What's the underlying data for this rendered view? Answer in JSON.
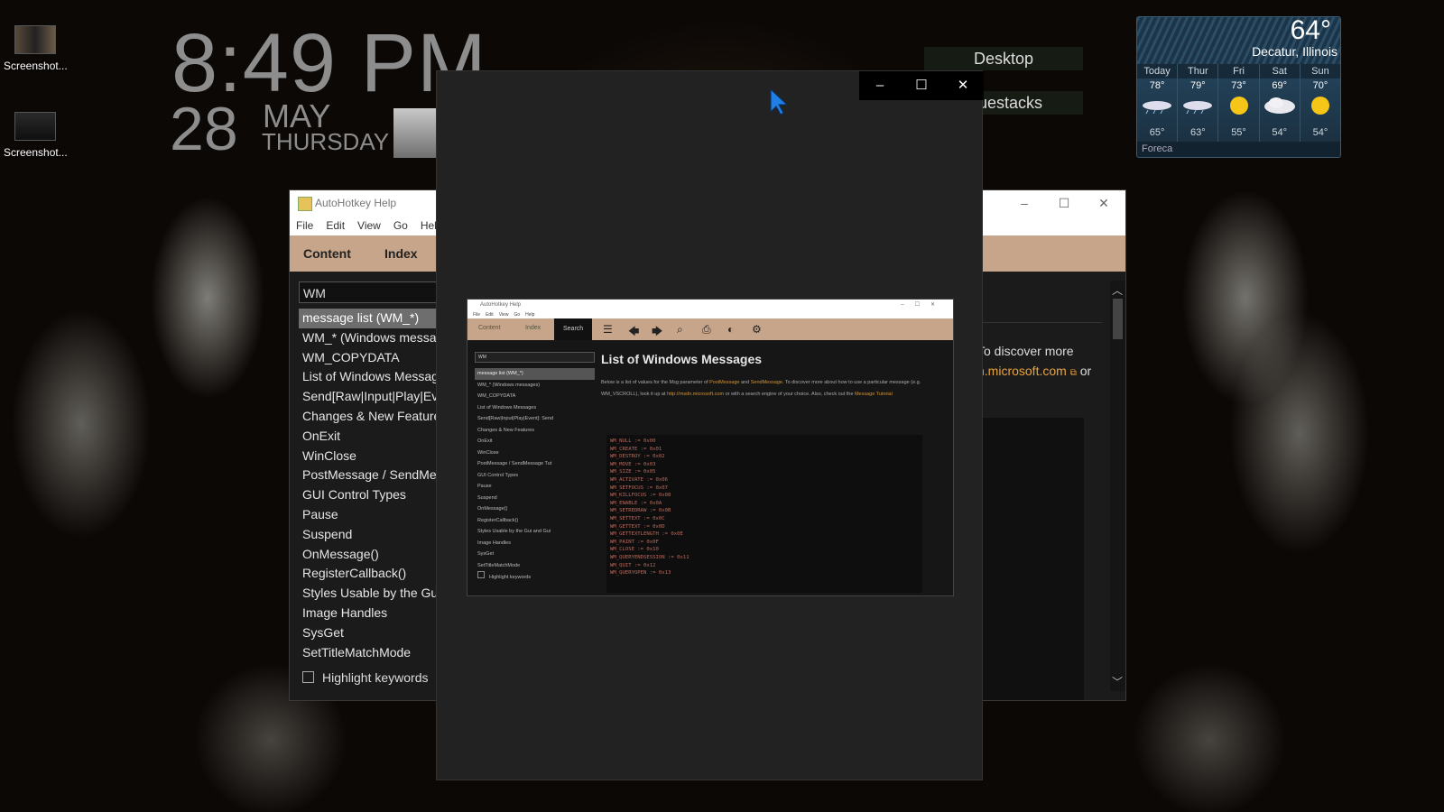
{
  "desktop": {
    "icons": [
      {
        "label": "Screenshot..."
      },
      {
        "label": "Screenshot..."
      }
    ],
    "clock": {
      "time": "8:49 PM",
      "day": "28",
      "month": "MAY",
      "weekday": "THURSDAY"
    },
    "gadget_buttons": [
      "Desktop",
      "uestacks"
    ]
  },
  "weather": {
    "current_temp": "64°",
    "city": "Decatur, Illinois",
    "provider": "Foreca",
    "forecast": [
      {
        "day": "Today",
        "hi": "78°",
        "lo": "65°",
        "icon": "rain-cloud-icon"
      },
      {
        "day": "Thur",
        "hi": "79°",
        "lo": "63°",
        "icon": "rain-cloud-icon"
      },
      {
        "day": "Fri",
        "hi": "73°",
        "lo": "55°",
        "icon": "sun-icon"
      },
      {
        "day": "Sat",
        "hi": "69°",
        "lo": "54°",
        "icon": "cloud-icon"
      },
      {
        "day": "Sun",
        "hi": "70°",
        "lo": "54°",
        "icon": "sun-icon"
      }
    ]
  },
  "ahk_window": {
    "title": "AutoHotkey Help",
    "menu": [
      "File",
      "Edit",
      "View",
      "Go",
      "Help"
    ],
    "tabs": [
      "Content",
      "Index"
    ],
    "search_value": "WM",
    "index_items": [
      "message list (WM_*)",
      "WM_* (Windows messag",
      "WM_COPYDATA",
      "List of Windows Messag",
      "Send[Raw|Input|Play|Ev",
      "Changes & New Feature",
      "OnExit",
      "WinClose",
      "PostMessage / SendMes",
      "GUI Control Types",
      "Pause",
      "Suspend",
      "OnMessage()",
      "RegisterCallback()",
      "Styles Usable by the Gui",
      "Image Handles",
      "SysGet",
      "SetTitleMatchMode"
    ],
    "selected_index": 0,
    "highlight_keywords_label": "Highlight keywords",
    "content_text_1": "To discover more",
    "content_link": "n.microsoft.com",
    "content_text_2": "or"
  },
  "viewer": {
    "window_controls": {
      "minimize": "–",
      "maximize": "☐",
      "close": "✕"
    },
    "preview": {
      "title": "AutoHotkey Help",
      "menu": [
        "File",
        "Edit",
        "View",
        "Go",
        "Help"
      ],
      "tabs": [
        "Content",
        "Index",
        "Search"
      ],
      "search_value": "WM",
      "items": [
        "message list (WM_*)",
        "WM_* (Windows messages)",
        "WM_COPYDATA",
        "List of Windows Messages",
        "Send[Raw|Input|Play|Event]: Send",
        "Changes & New Features",
        "OnExit",
        "WinClose",
        "PostMessage / SendMessage Tut",
        "GUI Control Types",
        "Pause",
        "Suspend",
        "OnMessage()",
        "RegisterCallback()",
        "Styles Usable by the Gui and Gui",
        "Image Handles",
        "SysGet",
        "SetTitleMatchMode"
      ],
      "highlight_label": "Highlight keywords",
      "heading": "List of Windows Messages",
      "para_1": "Below is a list of values for the Msg parameter of",
      "link_1": "PostMessage",
      "para_and": "and",
      "link_2": "SendMessage",
      "para_2": ". To discover more about how to use a particular message (e.g. WM_VSCROLL), look it up at",
      "link_3": "http://msdn.microsoft.com",
      "para_3": "or with a search engine of your choice. Also, check out the",
      "link_4": "Message Tutorial",
      "code_lines": [
        "WM_NULL := 0x00",
        "WM_CREATE := 0x01",
        "WM_DESTROY := 0x02",
        "WM_MOVE := 0x03",
        "WM_SIZE := 0x05",
        "WM_ACTIVATE := 0x06",
        "WM_SETFOCUS := 0x07",
        "WM_KILLFOCUS := 0x08",
        "WM_ENABLE := 0x0A",
        "WM_SETREDRAW := 0x0B",
        "WM_SETTEXT := 0x0C",
        "WM_GETTEXT := 0x0D",
        "WM_GETTEXTLENGTH := 0x0E",
        "WM_PAINT := 0x0F",
        "WM_CLOSE := 0x10",
        "WM_QUERYENDSESSION := 0x11",
        "WM_QUIT := 0x12",
        "WM_QUERYOPEN := 0x13"
      ]
    }
  }
}
